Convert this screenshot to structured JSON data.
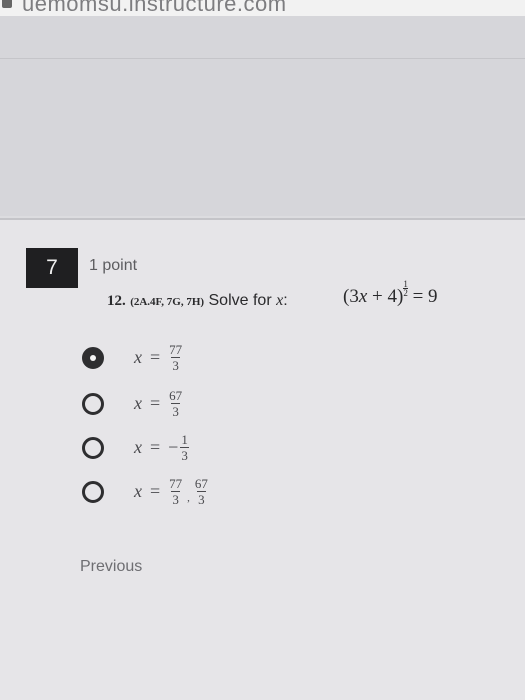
{
  "browser": {
    "url_fragment": "uemomsu.instructure.com"
  },
  "question": {
    "number": "7",
    "points": "1 point",
    "item_number": "12.",
    "standards": "(2A.4F, 7G, 7H)",
    "prompt_text": "Solve for",
    "prompt_var": "x",
    "prompt_colon": ":",
    "equation_base": "(3",
    "equation_var": "x",
    "equation_rest": " + 4)",
    "exponent_num": "1",
    "exponent_den": "2",
    "equation_rhs": " = 9"
  },
  "options": [
    {
      "var": "x",
      "eq": "=",
      "sign": "",
      "num": "77",
      "den": "3",
      "selected": true
    },
    {
      "var": "x",
      "eq": "=",
      "sign": "",
      "num": "67",
      "den": "3",
      "selected": false
    },
    {
      "var": "x",
      "eq": "=",
      "sign": "−",
      "num": "1",
      "den": "3",
      "selected": false
    },
    {
      "var": "x",
      "eq": "=",
      "sign": "",
      "num": "77",
      "den": "3",
      "sep": ",",
      "num2": "67",
      "den2": "3",
      "selected": false
    }
  ],
  "navigation": {
    "previous_label": "Previous"
  }
}
